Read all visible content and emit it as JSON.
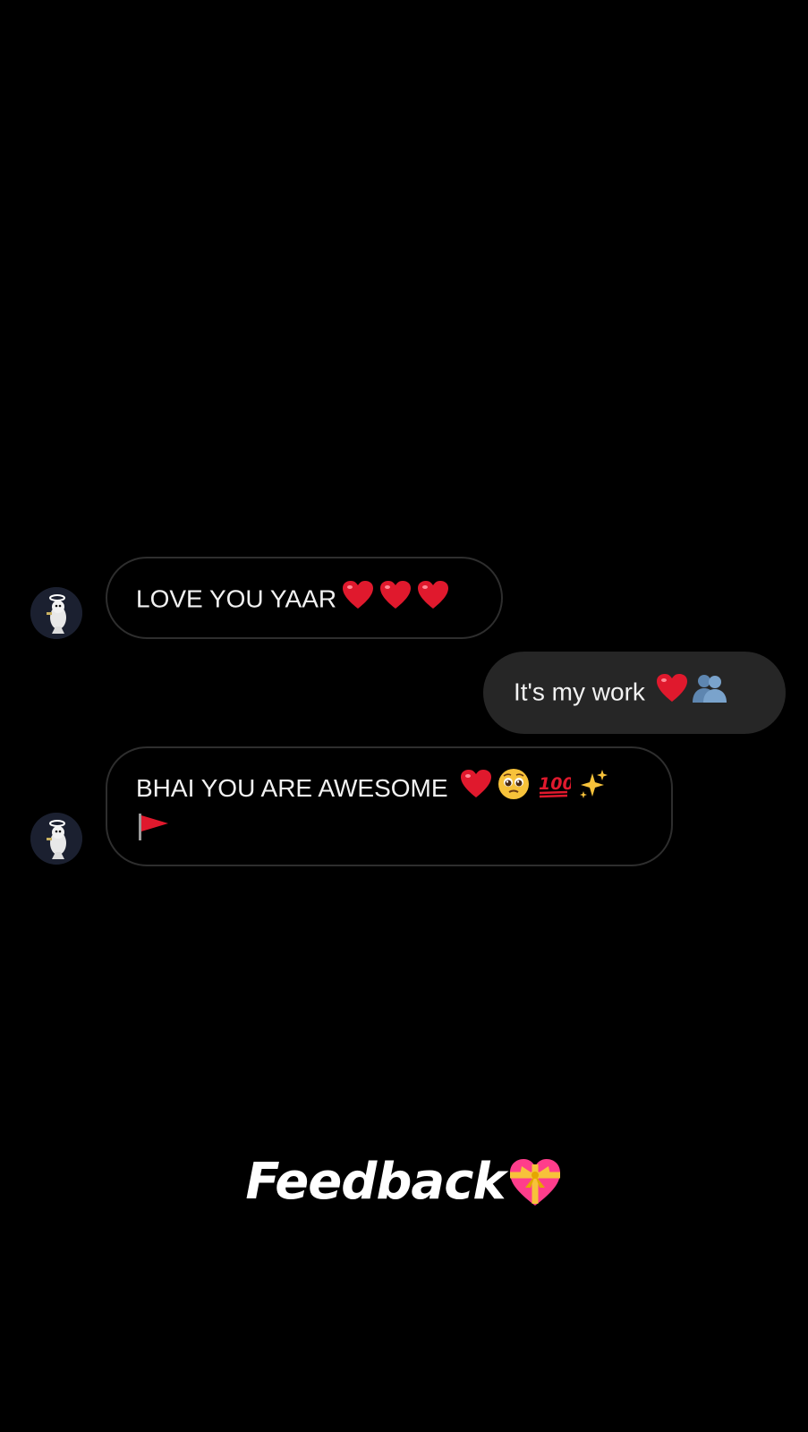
{
  "messages": [
    {
      "sender": "other",
      "text": "LOVE YOU YAAR",
      "emojis": [
        "red-heart",
        "red-heart",
        "red-heart"
      ]
    },
    {
      "sender": "me",
      "text": "It's my work",
      "emojis": [
        "red-heart",
        "two-people-silhouette"
      ]
    },
    {
      "sender": "other",
      "text": "BHAI YOU ARE AWESOME",
      "emojis": [
        "red-heart",
        "pleading-face",
        "hundred-points",
        "sparkles",
        "red-flag"
      ]
    }
  ],
  "caption": {
    "text": "Feedback",
    "emoji": "heart-with-ribbon"
  },
  "colors": {
    "background": "#000000",
    "incoming_bubble_border": "#2e2e2e",
    "outgoing_bubble": "#262626",
    "text": "#f2f2f2",
    "heart": "#e0192d"
  }
}
